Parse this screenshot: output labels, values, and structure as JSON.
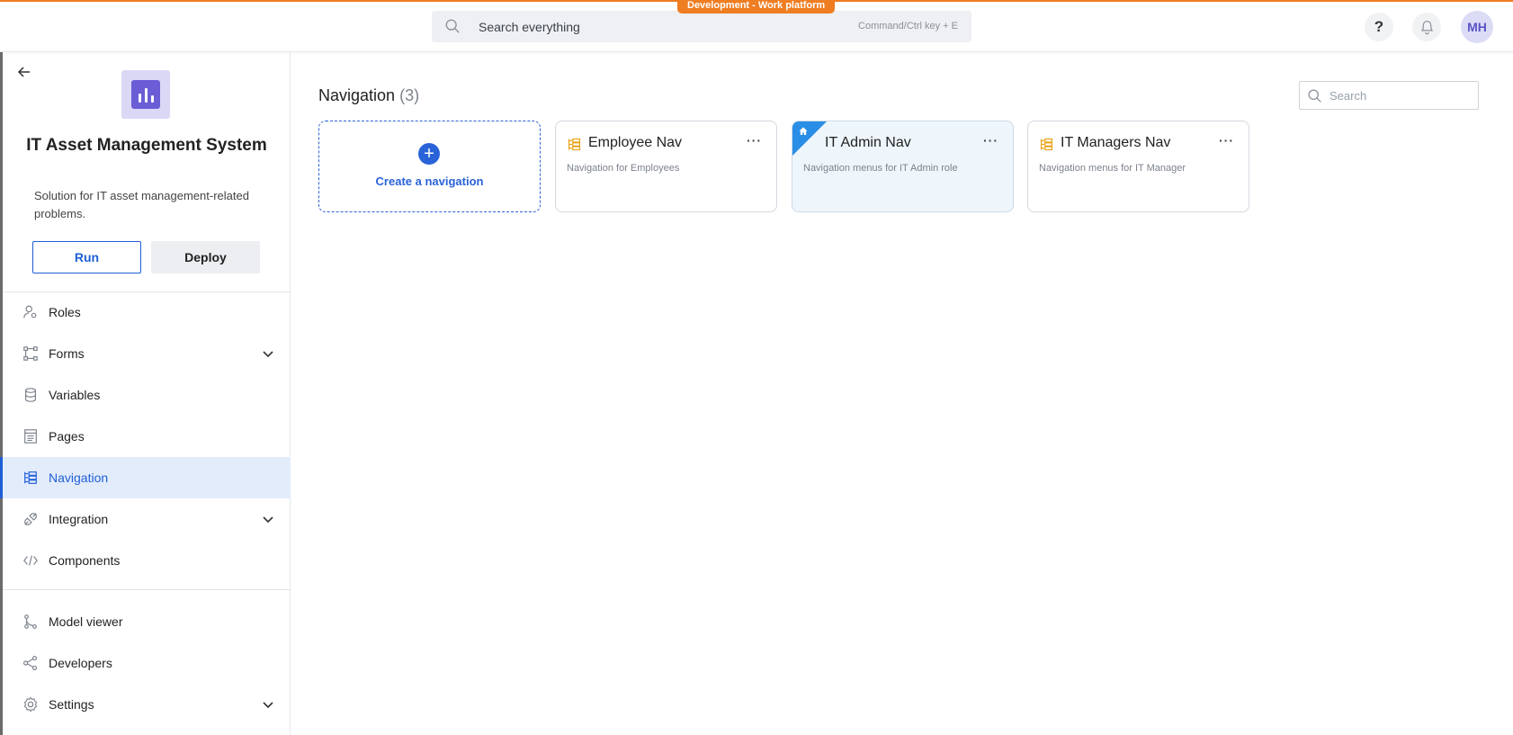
{
  "topbar": {
    "env_badge": "Development - Work platform",
    "search_text": "Search everything",
    "search_hint": "Command/Ctrl key + E",
    "help_label": "?",
    "avatar_initials": "MH"
  },
  "sidebar": {
    "app_title": "IT Asset Management System",
    "app_description": "Solution for IT asset management-related problems.",
    "run_label": "Run",
    "deploy_label": "Deploy",
    "items": [
      {
        "label": "Roles",
        "icon": "roles-icon"
      },
      {
        "label": "Forms",
        "icon": "forms-icon",
        "expandable": true
      },
      {
        "label": "Variables",
        "icon": "database-icon"
      },
      {
        "label": "Pages",
        "icon": "pages-icon"
      },
      {
        "label": "Navigation",
        "icon": "navigation-icon",
        "active": true
      },
      {
        "label": "Integration",
        "icon": "integration-icon",
        "expandable": true
      },
      {
        "label": "Components",
        "icon": "code-icon"
      },
      {
        "label": "Model viewer",
        "icon": "model-viewer-icon"
      },
      {
        "label": "Developers",
        "icon": "share-icon"
      },
      {
        "label": "Settings",
        "icon": "gear-icon",
        "expandable": true
      }
    ]
  },
  "main": {
    "title": "Navigation",
    "count": "(3)",
    "search_placeholder": "Search",
    "create_label": "Create a navigation",
    "cards": [
      {
        "title": "Employee Nav",
        "description": "Navigation for Employees",
        "home": false
      },
      {
        "title": "IT Admin Nav",
        "description": "Navigation menus for IT Admin role",
        "home": true
      },
      {
        "title": "IT Managers Nav",
        "description": "Navigation menus for IT Manager",
        "home": false
      }
    ],
    "more_label": "···"
  },
  "colors": {
    "accent": "#1f5fd6",
    "env_badge": "#ef7d22",
    "nav_icon": "#e8a317",
    "home_ribbon": "#2a8ee6"
  }
}
